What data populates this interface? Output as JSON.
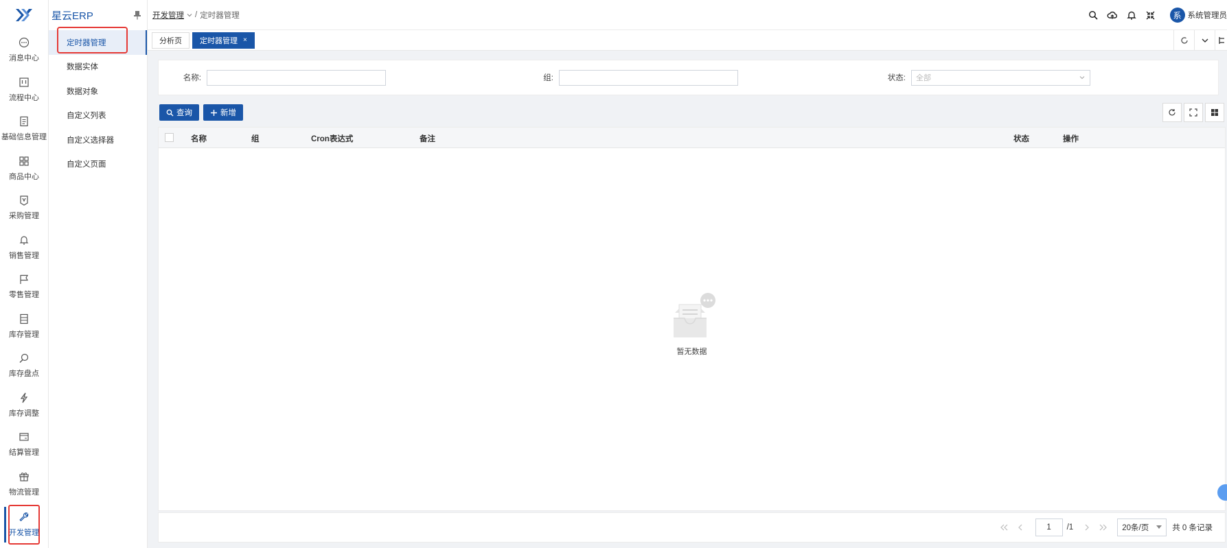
{
  "rail": {
    "items": [
      {
        "label": "消息中心",
        "icon": "message-icon"
      },
      {
        "label": "流程中心",
        "icon": "flow-icon"
      },
      {
        "label": "基础信息管理",
        "icon": "document-icon"
      },
      {
        "label": "商品中心",
        "icon": "grid-icon"
      },
      {
        "label": "采购管理",
        "icon": "purchase-icon"
      },
      {
        "label": "销售管理",
        "icon": "bell-icon"
      },
      {
        "label": "零售管理",
        "icon": "flag-icon"
      },
      {
        "label": "库存管理",
        "icon": "storage-icon"
      },
      {
        "label": "库存盘点",
        "icon": "search-icon"
      },
      {
        "label": "库存调整",
        "icon": "lightning-icon"
      },
      {
        "label": "结算管理",
        "icon": "wallet-icon"
      },
      {
        "label": "物流管理",
        "icon": "gift-icon"
      },
      {
        "label": "开发管理",
        "icon": "wrench-icon"
      }
    ]
  },
  "sub": {
    "brand": "星云ERP",
    "items": [
      "定时器管理",
      "数据实体",
      "数据对象",
      "自定义列表",
      "自定义选择器",
      "自定义页面"
    ]
  },
  "header": {
    "breadcrumb_root": "开发管理",
    "breadcrumb_sep": "/",
    "breadcrumb_current": "定时器管理",
    "avatar_text": "系",
    "user_name": "系统管理员"
  },
  "tabs": [
    {
      "label": "分析页"
    },
    {
      "label": "定时器管理",
      "close": "×"
    }
  ],
  "filters": {
    "name_label": "名称:",
    "group_label": "组:",
    "status_label": "状态:",
    "status_value": "全部"
  },
  "actions": {
    "query": "查询",
    "add": "新增"
  },
  "table": {
    "columns": [
      "名称",
      "组",
      "Cron表达式",
      "备注",
      "状态",
      "操作"
    ],
    "empty_text": "暂无数据"
  },
  "pager": {
    "page": "1",
    "total_pages": "/1",
    "page_size": "20条/页",
    "total": "共 0 条记录"
  },
  "colors": {
    "primary": "#1a56a8",
    "highlight": "#e53935"
  }
}
